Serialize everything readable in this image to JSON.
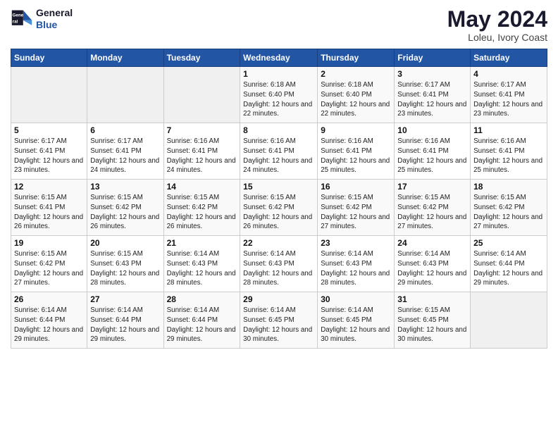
{
  "header": {
    "logo_line1": "General",
    "logo_line2": "Blue",
    "month_year": "May 2024",
    "location": "Loleu, Ivory Coast"
  },
  "days_of_week": [
    "Sunday",
    "Monday",
    "Tuesday",
    "Wednesday",
    "Thursday",
    "Friday",
    "Saturday"
  ],
  "weeks": [
    [
      {
        "day": "",
        "sunrise": "",
        "sunset": "",
        "daylight": ""
      },
      {
        "day": "",
        "sunrise": "",
        "sunset": "",
        "daylight": ""
      },
      {
        "day": "",
        "sunrise": "",
        "sunset": "",
        "daylight": ""
      },
      {
        "day": "1",
        "sunrise": "Sunrise: 6:18 AM",
        "sunset": "Sunset: 6:40 PM",
        "daylight": "Daylight: 12 hours and 22 minutes."
      },
      {
        "day": "2",
        "sunrise": "Sunrise: 6:18 AM",
        "sunset": "Sunset: 6:40 PM",
        "daylight": "Daylight: 12 hours and 22 minutes."
      },
      {
        "day": "3",
        "sunrise": "Sunrise: 6:17 AM",
        "sunset": "Sunset: 6:41 PM",
        "daylight": "Daylight: 12 hours and 23 minutes."
      },
      {
        "day": "4",
        "sunrise": "Sunrise: 6:17 AM",
        "sunset": "Sunset: 6:41 PM",
        "daylight": "Daylight: 12 hours and 23 minutes."
      }
    ],
    [
      {
        "day": "5",
        "sunrise": "Sunrise: 6:17 AM",
        "sunset": "Sunset: 6:41 PM",
        "daylight": "Daylight: 12 hours and 23 minutes."
      },
      {
        "day": "6",
        "sunrise": "Sunrise: 6:17 AM",
        "sunset": "Sunset: 6:41 PM",
        "daylight": "Daylight: 12 hours and 24 minutes."
      },
      {
        "day": "7",
        "sunrise": "Sunrise: 6:16 AM",
        "sunset": "Sunset: 6:41 PM",
        "daylight": "Daylight: 12 hours and 24 minutes."
      },
      {
        "day": "8",
        "sunrise": "Sunrise: 6:16 AM",
        "sunset": "Sunset: 6:41 PM",
        "daylight": "Daylight: 12 hours and 24 minutes."
      },
      {
        "day": "9",
        "sunrise": "Sunrise: 6:16 AM",
        "sunset": "Sunset: 6:41 PM",
        "daylight": "Daylight: 12 hours and 25 minutes."
      },
      {
        "day": "10",
        "sunrise": "Sunrise: 6:16 AM",
        "sunset": "Sunset: 6:41 PM",
        "daylight": "Daylight: 12 hours and 25 minutes."
      },
      {
        "day": "11",
        "sunrise": "Sunrise: 6:16 AM",
        "sunset": "Sunset: 6:41 PM",
        "daylight": "Daylight: 12 hours and 25 minutes."
      }
    ],
    [
      {
        "day": "12",
        "sunrise": "Sunrise: 6:15 AM",
        "sunset": "Sunset: 6:41 PM",
        "daylight": "Daylight: 12 hours and 26 minutes."
      },
      {
        "day": "13",
        "sunrise": "Sunrise: 6:15 AM",
        "sunset": "Sunset: 6:42 PM",
        "daylight": "Daylight: 12 hours and 26 minutes."
      },
      {
        "day": "14",
        "sunrise": "Sunrise: 6:15 AM",
        "sunset": "Sunset: 6:42 PM",
        "daylight": "Daylight: 12 hours and 26 minutes."
      },
      {
        "day": "15",
        "sunrise": "Sunrise: 6:15 AM",
        "sunset": "Sunset: 6:42 PM",
        "daylight": "Daylight: 12 hours and 26 minutes."
      },
      {
        "day": "16",
        "sunrise": "Sunrise: 6:15 AM",
        "sunset": "Sunset: 6:42 PM",
        "daylight": "Daylight: 12 hours and 27 minutes."
      },
      {
        "day": "17",
        "sunrise": "Sunrise: 6:15 AM",
        "sunset": "Sunset: 6:42 PM",
        "daylight": "Daylight: 12 hours and 27 minutes."
      },
      {
        "day": "18",
        "sunrise": "Sunrise: 6:15 AM",
        "sunset": "Sunset: 6:42 PM",
        "daylight": "Daylight: 12 hours and 27 minutes."
      }
    ],
    [
      {
        "day": "19",
        "sunrise": "Sunrise: 6:15 AM",
        "sunset": "Sunset: 6:42 PM",
        "daylight": "Daylight: 12 hours and 27 minutes."
      },
      {
        "day": "20",
        "sunrise": "Sunrise: 6:15 AM",
        "sunset": "Sunset: 6:43 PM",
        "daylight": "Daylight: 12 hours and 28 minutes."
      },
      {
        "day": "21",
        "sunrise": "Sunrise: 6:14 AM",
        "sunset": "Sunset: 6:43 PM",
        "daylight": "Daylight: 12 hours and 28 minutes."
      },
      {
        "day": "22",
        "sunrise": "Sunrise: 6:14 AM",
        "sunset": "Sunset: 6:43 PM",
        "daylight": "Daylight: 12 hours and 28 minutes."
      },
      {
        "day": "23",
        "sunrise": "Sunrise: 6:14 AM",
        "sunset": "Sunset: 6:43 PM",
        "daylight": "Daylight: 12 hours and 28 minutes."
      },
      {
        "day": "24",
        "sunrise": "Sunrise: 6:14 AM",
        "sunset": "Sunset: 6:43 PM",
        "daylight": "Daylight: 12 hours and 29 minutes."
      },
      {
        "day": "25",
        "sunrise": "Sunrise: 6:14 AM",
        "sunset": "Sunset: 6:44 PM",
        "daylight": "Daylight: 12 hours and 29 minutes."
      }
    ],
    [
      {
        "day": "26",
        "sunrise": "Sunrise: 6:14 AM",
        "sunset": "Sunset: 6:44 PM",
        "daylight": "Daylight: 12 hours and 29 minutes."
      },
      {
        "day": "27",
        "sunrise": "Sunrise: 6:14 AM",
        "sunset": "Sunset: 6:44 PM",
        "daylight": "Daylight: 12 hours and 29 minutes."
      },
      {
        "day": "28",
        "sunrise": "Sunrise: 6:14 AM",
        "sunset": "Sunset: 6:44 PM",
        "daylight": "Daylight: 12 hours and 29 minutes."
      },
      {
        "day": "29",
        "sunrise": "Sunrise: 6:14 AM",
        "sunset": "Sunset: 6:45 PM",
        "daylight": "Daylight: 12 hours and 30 minutes."
      },
      {
        "day": "30",
        "sunrise": "Sunrise: 6:14 AM",
        "sunset": "Sunset: 6:45 PM",
        "daylight": "Daylight: 12 hours and 30 minutes."
      },
      {
        "day": "31",
        "sunrise": "Sunrise: 6:15 AM",
        "sunset": "Sunset: 6:45 PM",
        "daylight": "Daylight: 12 hours and 30 minutes."
      },
      {
        "day": "",
        "sunrise": "",
        "sunset": "",
        "daylight": ""
      }
    ]
  ]
}
